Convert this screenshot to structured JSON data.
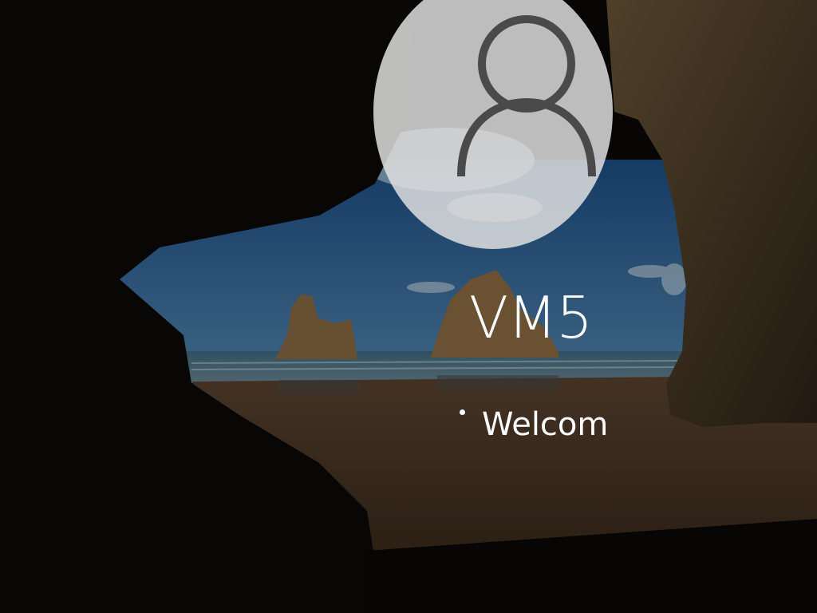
{
  "login": {
    "account_name": "VM5",
    "status_text": "Welcom"
  },
  "icons": {
    "avatar": "user-avatar-icon",
    "spinner": "loading-dot-icon"
  },
  "colors": {
    "text": "#ffffff",
    "avatar_circle": "#e1e1e1",
    "avatar_glyph": "#4a4a4a"
  }
}
